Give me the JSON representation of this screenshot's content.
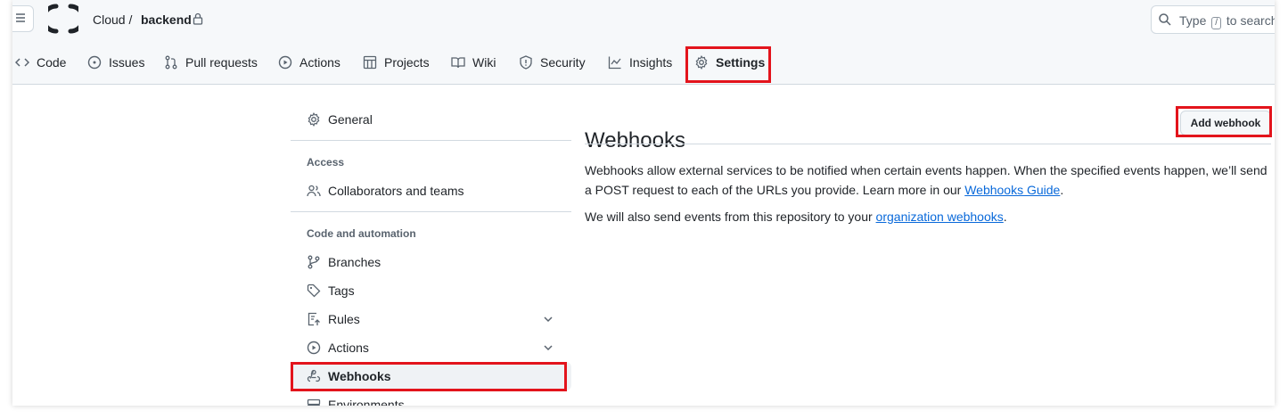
{
  "header": {
    "owner": "Cloud /",
    "repo": "backend",
    "search": {
      "placeholder_prefix": "Type",
      "shortcut": "/",
      "placeholder_suffix": "to search"
    }
  },
  "tabs": [
    {
      "label": "Code",
      "icon": "code-icon"
    },
    {
      "label": "Issues",
      "icon": "issue-icon"
    },
    {
      "label": "Pull requests",
      "icon": "pull-request-icon"
    },
    {
      "label": "Actions",
      "icon": "play-icon"
    },
    {
      "label": "Projects",
      "icon": "table-icon"
    },
    {
      "label": "Wiki",
      "icon": "book-icon"
    },
    {
      "label": "Security",
      "icon": "shield-icon"
    },
    {
      "label": "Insights",
      "icon": "graph-icon"
    },
    {
      "label": "Settings",
      "icon": "gear-icon",
      "active": true
    }
  ],
  "sidebar": {
    "general": "General",
    "access_heading": "Access",
    "collaborators": "Collaborators and teams",
    "code_heading": "Code and automation",
    "branches": "Branches",
    "tags": "Tags",
    "rules": "Rules",
    "actions": "Actions",
    "webhooks": "Webhooks",
    "environments": "Environments"
  },
  "main": {
    "title": "Webhooks",
    "add_button": "Add webhook",
    "desc1_text": "Webhooks allow external services to be notified when certain events happen. When the specified events happen, we’ll send a POST request to each of the URLs you provide. Learn more in our ",
    "desc1_link": "Webhooks Guide",
    "desc1_end": ".",
    "desc2_text": "We will also send events from this repository to your ",
    "desc2_link": "organization webhooks",
    "desc2_end": "."
  },
  "colors": {
    "highlight_box": "#e3141c",
    "link": "#0969da",
    "header_bg": "#f6f8fa"
  }
}
